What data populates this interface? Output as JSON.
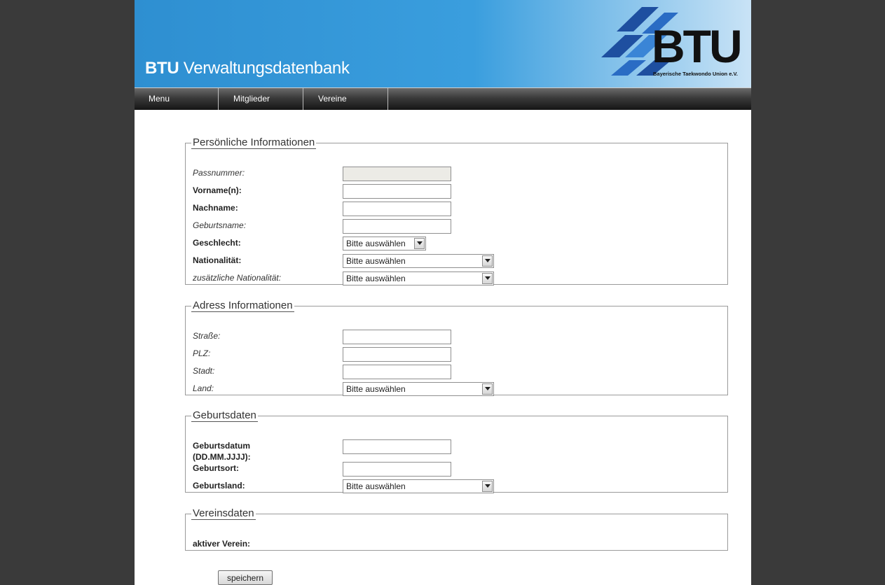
{
  "header": {
    "app_title_bold": "BTU",
    "app_title_rest": " Verwaltungsdatenbank",
    "logo_text": "BTU",
    "logo_subtitle": "Bayerische Taekwondo Union e.V."
  },
  "nav": {
    "items": [
      {
        "label": "Menu"
      },
      {
        "label": "Mitglieder"
      },
      {
        "label": "Vereine"
      }
    ]
  },
  "sections": {
    "personal": {
      "legend": "Persönliche Informationen",
      "passnummer": {
        "label": "Passnummer:",
        "value": ""
      },
      "vorname": {
        "label": "Vorname(n):",
        "value": ""
      },
      "nachname": {
        "label": "Nachname:",
        "value": ""
      },
      "geburtsname": {
        "label": "Geburtsname:",
        "value": ""
      },
      "geschlecht": {
        "label": "Geschlecht:",
        "selected": "Bitte auswählen"
      },
      "nationalitaet": {
        "label": "Nationalität:",
        "selected": "Bitte auswählen"
      },
      "zusatz_nationalitaet": {
        "label": "zusätzliche Nationalität:",
        "selected": "Bitte auswählen"
      }
    },
    "address": {
      "legend": "Adress Informationen",
      "strasse": {
        "label": "Straße:",
        "value": ""
      },
      "plz": {
        "label": "PLZ:",
        "value": ""
      },
      "stadt": {
        "label": "Stadt:",
        "value": ""
      },
      "land": {
        "label": "Land:",
        "selected": "Bitte auswählen"
      }
    },
    "birth": {
      "legend": "Geburtsdaten",
      "geburtsdatum": {
        "label_line1": "Geburtsdatum",
        "label_line2": "(DD.MM.JJJJ):",
        "value": ""
      },
      "geburtsort": {
        "label": "Geburtsort:",
        "value": ""
      },
      "geburtsland": {
        "label": "Geburtsland:",
        "selected": "Bitte auswählen"
      }
    },
    "club": {
      "legend": "Vereinsdaten",
      "aktiver_verein": {
        "label": "aktiver Verein:"
      }
    }
  },
  "actions": {
    "save_label": "speichern"
  },
  "colors": {
    "background": "#3a3a3a",
    "banner_blue": "#2e8fd1",
    "nav_dark": "#2a2a2a"
  }
}
